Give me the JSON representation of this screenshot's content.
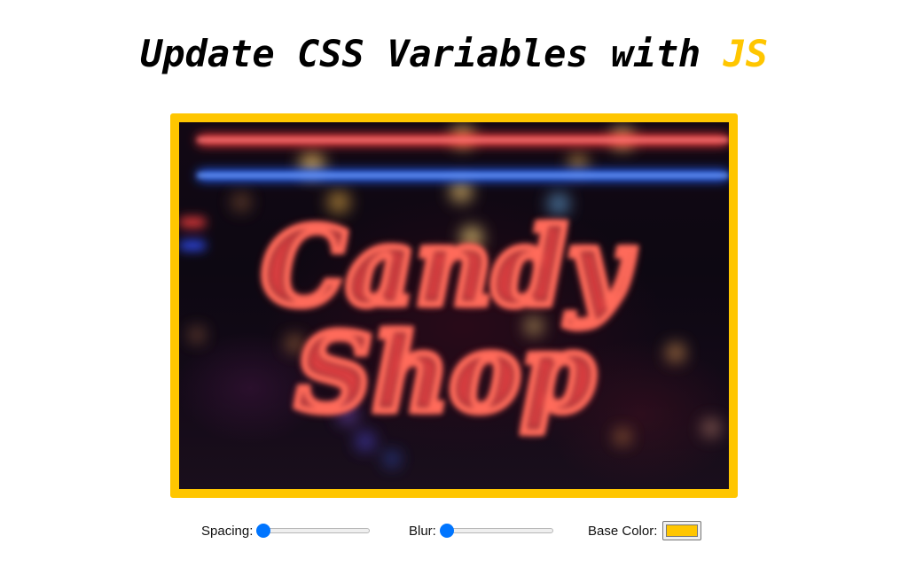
{
  "heading": {
    "prefix": "Update CSS Variables with ",
    "highlight": "JS"
  },
  "colors": {
    "base": "#ffc600"
  },
  "image": {
    "description_icon": "candy-shop-neon-photo"
  },
  "controls": {
    "spacing": {
      "label": "Spacing:",
      "value": 0
    },
    "blur": {
      "label": "Blur:",
      "value": 0
    },
    "base_color": {
      "label": "Base Color:",
      "value": "#ffc600"
    }
  }
}
